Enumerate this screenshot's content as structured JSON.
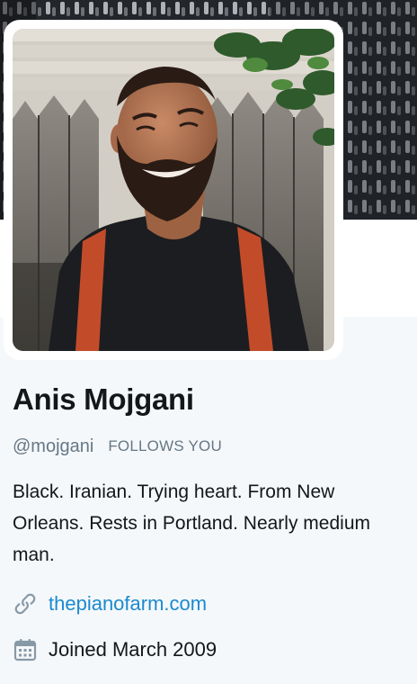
{
  "profile": {
    "display_name": "Anis Mojgani",
    "handle": "@mojgani",
    "follows_you_label": "FOLLOWS YOU",
    "bio": "Black. Iranian. Trying heart. From New Orleans. Rests in Portland. Nearly medium man.",
    "website": "thepianofarm.com",
    "joined": "Joined March 2009"
  },
  "icons": {
    "website": "link-icon",
    "joined": "calendar-icon"
  },
  "colors": {
    "link": "#1b8ad0",
    "secondary_text": "#657786",
    "primary_text": "#14171a",
    "page_background": "#f5f8fa"
  }
}
